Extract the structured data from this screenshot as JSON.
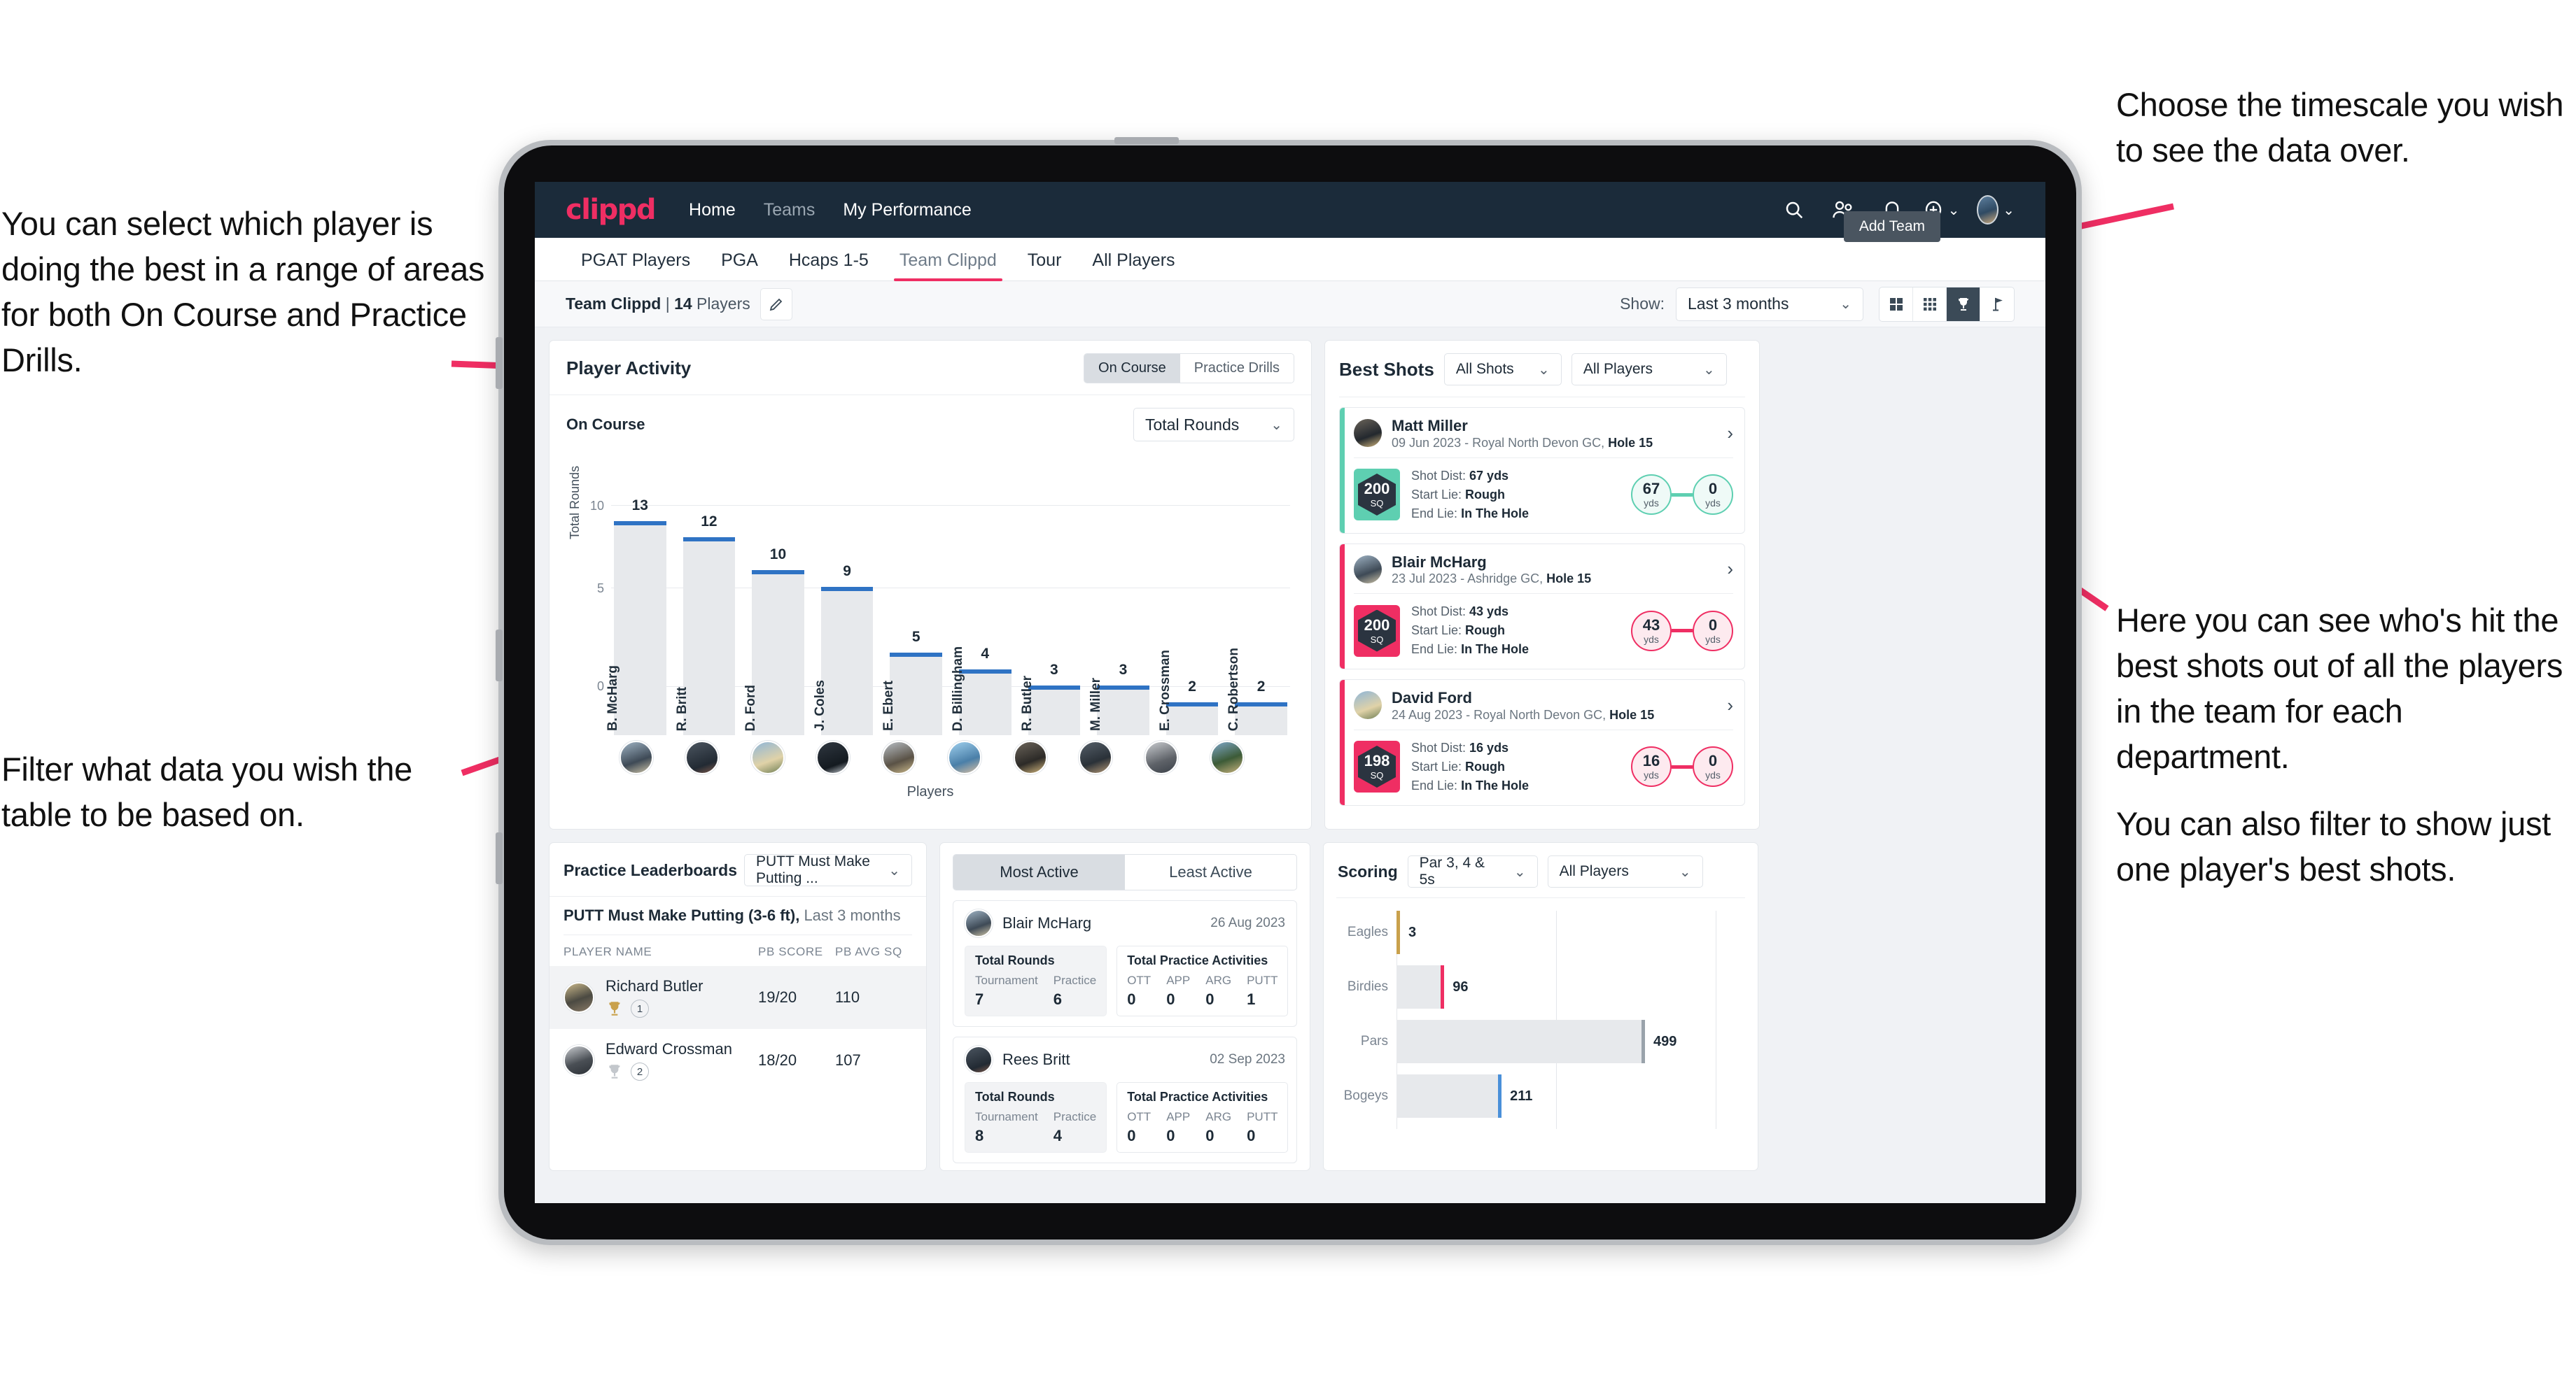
{
  "annotations": {
    "left_top": "You can select which player is doing the best in a range of areas for both On Course and Practice Drills.",
    "left_bottom": "Filter what data you wish the table to be based on.",
    "right_top": "Choose the timescale you wish to see the data over.",
    "right_mid": "Here you can see who's hit the best shots out of all the players in the team for each department.",
    "right_bottom": "You can also filter to show just one player's best shots."
  },
  "topnav": {
    "logo": "clippd",
    "links": [
      {
        "label": "Home",
        "dim": false
      },
      {
        "label": "Teams",
        "dim": true
      },
      {
        "label": "My Performance",
        "dim": false
      }
    ],
    "icons": [
      "search-icon",
      "people-icon",
      "bell-icon",
      "plus-circle-icon",
      "avatar"
    ]
  },
  "tabs": [
    {
      "label": "PGAT Players",
      "active": false
    },
    {
      "label": "PGA",
      "active": false
    },
    {
      "label": "Hcaps 1-5",
      "active": false
    },
    {
      "label": "Team Clippd",
      "active": true
    },
    {
      "label": "Tour",
      "active": false
    },
    {
      "label": "All Players",
      "active": false
    }
  ],
  "subbar": {
    "team_name": "Team Clippd",
    "separator": " | ",
    "player_count": "14",
    "players_word": " Players",
    "edit_icon": "pencil-icon",
    "show_label": "Show:",
    "timescale_value": "Last 3 months",
    "add_team_tooltip": "Add Team",
    "view_modes": [
      "grid-large-icon",
      "grid-small-icon",
      "trophy-icon",
      "flag-icon"
    ],
    "active_view": 2
  },
  "player_activity": {
    "title": "Player Activity",
    "segments": [
      {
        "label": "On Course",
        "active": true
      },
      {
        "label": "Practice Drills",
        "active": false
      }
    ],
    "sub_label": "On Course",
    "metric_select": "Total Rounds",
    "x_axis_label": "Players"
  },
  "best_shots": {
    "title": "Best Shots",
    "filter_shots": "All Shots",
    "filter_players": "All Players",
    "cards": [
      {
        "name": "Matt Miller",
        "meta_date": "09 Jun 2023 - Royal North Devon GC, ",
        "meta_hole": "Hole 15",
        "sq": "200",
        "sq_unit": "SQ",
        "accent": "#5ecfb1",
        "shot_dist_label": "Shot Dist: ",
        "shot_dist": "67 yds",
        "start_lie_label": "Start Lie: ",
        "start_lie": "Rough",
        "end_lie_label": "End Lie: ",
        "end_lie": "In The Hole",
        "from_val": "67",
        "from_unit": "yds",
        "to_val": "0",
        "to_unit": "yds"
      },
      {
        "name": "Blair McHarg",
        "meta_date": "23 Jul 2023 - Ashridge GC, ",
        "meta_hole": "Hole 15",
        "sq": "200",
        "sq_unit": "SQ",
        "accent": "#ef2e63",
        "shot_dist_label": "Shot Dist: ",
        "shot_dist": "43 yds",
        "start_lie_label": "Start Lie: ",
        "start_lie": "Rough",
        "end_lie_label": "End Lie: ",
        "end_lie": "In The Hole",
        "from_val": "43",
        "from_unit": "yds",
        "to_val": "0",
        "to_unit": "yds"
      },
      {
        "name": "David Ford",
        "meta_date": "24 Aug 2023 - Royal North Devon GC, ",
        "meta_hole": "Hole 15",
        "sq": "198",
        "sq_unit": "SQ",
        "accent": "#ef2e63",
        "shot_dist_label": "Shot Dist: ",
        "shot_dist": "16 yds",
        "start_lie_label": "Start Lie: ",
        "start_lie": "Rough",
        "end_lie_label": "End Lie: ",
        "end_lie": "In The Hole",
        "from_val": "16",
        "from_unit": "yds",
        "to_val": "0",
        "to_unit": "yds"
      }
    ]
  },
  "practice_leaderboards": {
    "title": "Practice Leaderboards",
    "drill_select": "PUTT Must Make Putting ...",
    "subtitle_bold": "PUTT Must Make Putting (3-6 ft),",
    "subtitle_rest": " Last 3 months",
    "columns": [
      "PLAYER NAME",
      "PB SCORE",
      "PB AVG SQ"
    ],
    "rows": [
      {
        "name": "Richard Butler",
        "rank": "1",
        "trophy": "gold",
        "pb_score": "19/20",
        "pb_avg_sq": "110",
        "highlight": true
      },
      {
        "name": "Edward Crossman",
        "rank": "2",
        "trophy": "silver",
        "pb_score": "18/20",
        "pb_avg_sq": "107",
        "highlight": false
      }
    ]
  },
  "activity_panel": {
    "tabs": [
      {
        "label": "Most Active",
        "active": true
      },
      {
        "label": "Least Active",
        "active": false
      }
    ],
    "rounds_title": "Total Rounds",
    "practice_title": "Total Practice Activities",
    "rounds_keys": [
      "Tournament",
      "Practice"
    ],
    "practice_keys": [
      "OTT",
      "APP",
      "ARG",
      "PUTT"
    ],
    "cards": [
      {
        "name": "Blair McHarg",
        "date": "26 Aug 2023",
        "rounds": [
          "7",
          "6"
        ],
        "practice": [
          "0",
          "0",
          "0",
          "1"
        ]
      },
      {
        "name": "Rees Britt",
        "date": "02 Sep 2023",
        "rounds": [
          "8",
          "4"
        ],
        "practice": [
          "0",
          "0",
          "0",
          "0"
        ]
      }
    ]
  },
  "scoring": {
    "title": "Scoring",
    "filter_par": "Par 3, 4 & 5s",
    "filter_players": "All Players"
  },
  "chart_data": [
    {
      "type": "bar",
      "title": "Player Activity - On Course",
      "xlabel": "Players",
      "ylabel": "Total Rounds",
      "ylim": [
        0,
        14
      ],
      "yticks": [
        0,
        5,
        10
      ],
      "grid": true,
      "bar_color": "#e7e9ec",
      "cap_color": "#2f73c4",
      "categories": [
        "B. McHarg",
        "R. Britt",
        "D. Ford",
        "J. Coles",
        "E. Ebert",
        "D. Billingham",
        "R. Butler",
        "M. Miller",
        "E. Crossman",
        "C. Robertson"
      ],
      "values": [
        13,
        12,
        10,
        9,
        5,
        4,
        3,
        3,
        2,
        2
      ]
    },
    {
      "type": "bar",
      "orientation": "horizontal",
      "title": "Scoring",
      "xlabel": "",
      "ylabel": "",
      "grid": true,
      "categories": [
        "Eagles",
        "Birdies",
        "Pars",
        "Bogeys"
      ],
      "values": [
        3,
        96,
        499,
        211
      ],
      "colors": [
        "#c9a14c",
        "#ef2e63",
        "#9aa3ab",
        "#4a90d9"
      ],
      "xlim": [
        0,
        700
      ]
    }
  ]
}
